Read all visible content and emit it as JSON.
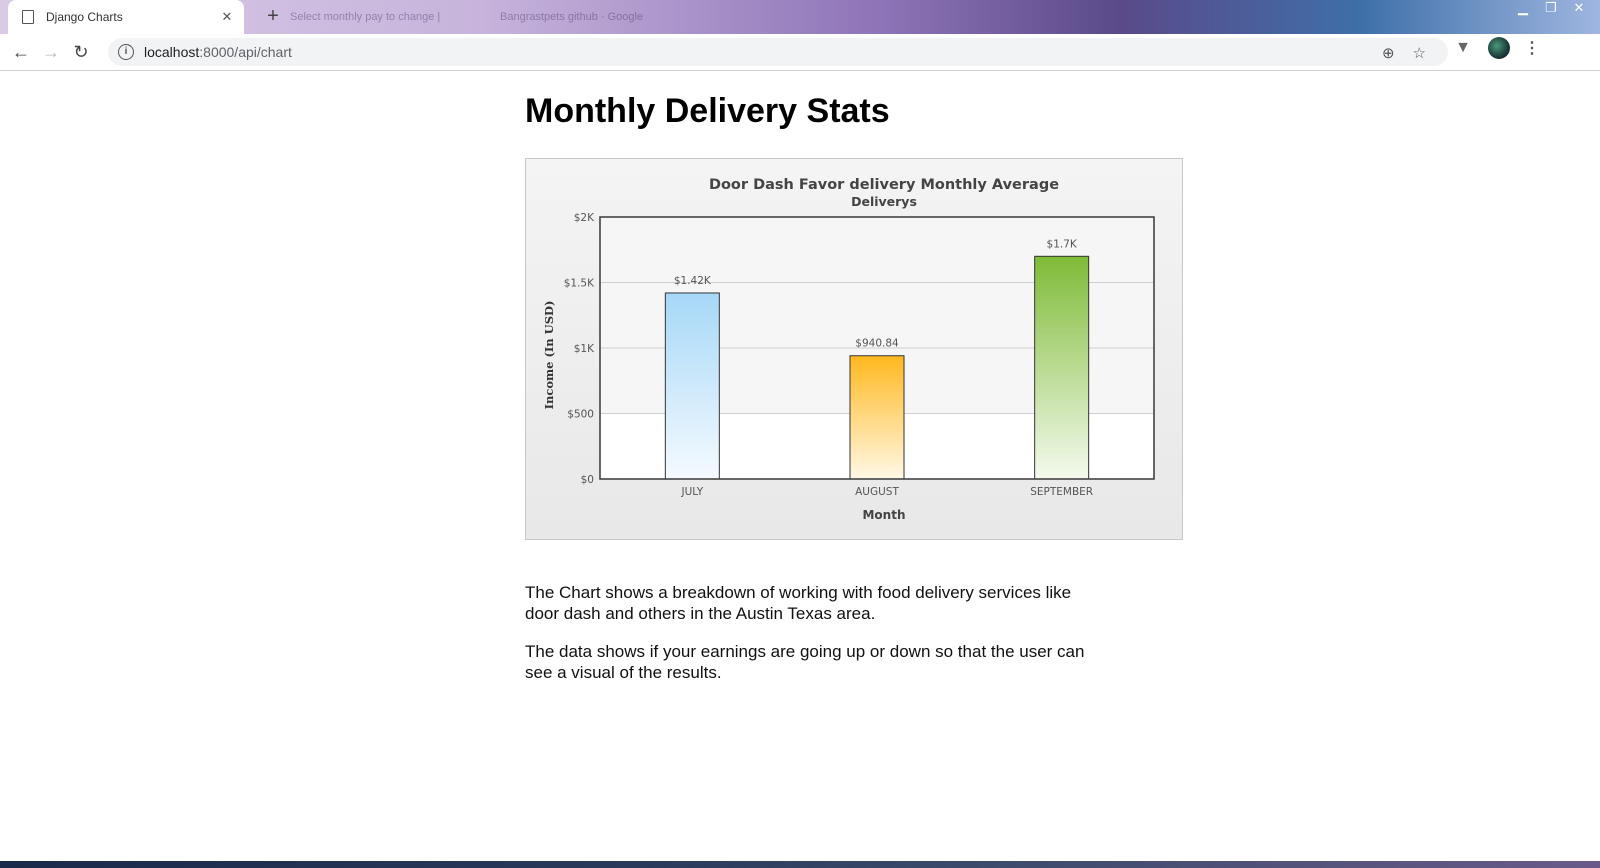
{
  "browser": {
    "active_tab_title": "Django Charts",
    "inactive_tab_1_title": "Select monthly pay to change |",
    "inactive_tab_2_title": "Bangrastpets github · Google",
    "url_host": "localhost",
    "url_path": ":8000/api/chart"
  },
  "page": {
    "title": "Monthly Delivery Stats",
    "paragraph_1": "The Chart shows a breakdown of working with food delivery services like door dash and others in the Austin Texas area.",
    "paragraph_2": "The data shows if your earnings are going up or down so that the user can see a visual of the results."
  },
  "chart_data": {
    "type": "bar",
    "title": "Door Dash Favor delivery Monthly Average",
    "subtitle": "Deliverys",
    "xlabel": "Month",
    "ylabel": "Income (In USD)",
    "categories": [
      "JULY",
      "AUGUST",
      "SEPTEMBER"
    ],
    "values": [
      1420,
      940.84,
      1700
    ],
    "value_labels": [
      "$1.42K",
      "$940.84",
      "$1.7K"
    ],
    "ylim": [
      0,
      2000
    ],
    "yticks": [
      0,
      500,
      1000,
      1500,
      2000
    ],
    "ytick_labels": [
      "$0",
      "$500",
      "$1K",
      "$1.5K",
      "$2K"
    ],
    "grid": true,
    "colors": [
      [
        "#a6d8f7",
        "#f5faff"
      ],
      [
        "#ffb81f",
        "#fff8e6"
      ],
      [
        "#7fbb38",
        "#f4faee"
      ]
    ]
  }
}
